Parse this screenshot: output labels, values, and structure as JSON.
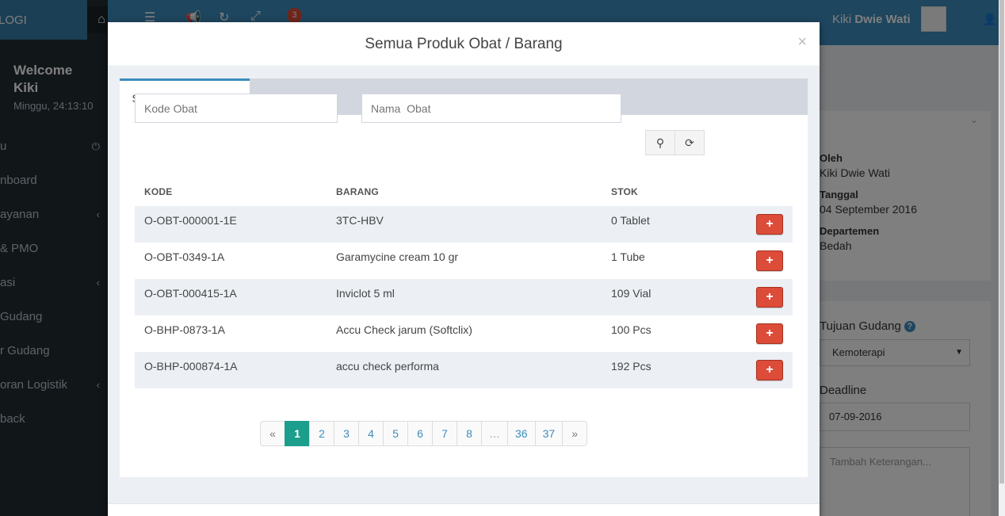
{
  "app": {
    "logo_text": "LOGI",
    "welcome": "Welcome Kiki",
    "clock": "Minggu, 24:13:10",
    "menu": [
      {
        "label": "u",
        "arrow": "⏻"
      },
      {
        "label": "nboard",
        "arrow": ""
      },
      {
        "label": "ayanan",
        "arrow": "‹"
      },
      {
        "label": "& PMO",
        "arrow": ""
      },
      {
        "label": "asi",
        "arrow": "‹"
      },
      {
        "label": "Gudang",
        "arrow": ""
      },
      {
        "label": "r Gudang",
        "arrow": ""
      },
      {
        "label": "oran Logistik",
        "arrow": "‹"
      },
      {
        "label": "back",
        "arrow": ""
      }
    ],
    "notif_count": "3",
    "user_first": "Kiki",
    "user_last": "Dwie Wati"
  },
  "right_panel": {
    "oleh_label": "Oleh",
    "oleh_value": "Kiki Dwie Wati",
    "tanggal_label": "Tanggal",
    "tanggal_value": "04 September 2016",
    "departemen_label": "Departemen",
    "departemen_value": "Bedah",
    "tujuan_label": "Tujuan Gudang",
    "tujuan_value": "Kemoterapi",
    "deadline_label": "Deadline",
    "deadline_value": "07-09-2016",
    "keterangan_placeholder": "Tambah Keterangan..."
  },
  "modal": {
    "title": "Semua Produk Obat / Barang",
    "close": "×",
    "tab_label": "Silahkan Pilih Barang",
    "kode_placeholder": "Kode Obat",
    "nama_placeholder": "Nama  Obat",
    "columns": {
      "kode": "KODE",
      "barang": "BARANG",
      "stok": "STOK"
    },
    "rows": [
      {
        "kode": "O-OBT-000001-1E",
        "barang": "3TC-HBV",
        "stok": "0 Tablet"
      },
      {
        "kode": "O-OBT-0349-1A",
        "barang": "Garamycine cream 10 gr",
        "stok": "1 Tube"
      },
      {
        "kode": "O-OBT-000415-1A",
        "barang": "Inviclot 5 ml",
        "stok": "109 Vial"
      },
      {
        "kode": "O-BHP-0873-1A",
        "barang": "Accu Check jarum (Softclix)",
        "stok": "100 Pcs"
      },
      {
        "kode": "O-BHP-000874-1A",
        "barang": "accu check performa",
        "stok": "192 Pcs"
      }
    ],
    "add_label": "+",
    "pagination": {
      "prev": "«",
      "pages": [
        "1",
        "2",
        "3",
        "4",
        "5",
        "6",
        "7",
        "8",
        "…",
        "36",
        "37"
      ],
      "active": "1",
      "next": "»"
    }
  }
}
